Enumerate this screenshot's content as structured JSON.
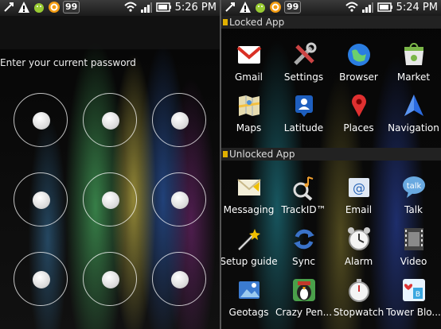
{
  "left_panel": {
    "status_bar": {
      "badge_count": "99",
      "time": "5:26 PM"
    },
    "prompt": "Enter your current password"
  },
  "right_panel": {
    "status_bar": {
      "badge_count": "99",
      "time": "5:24 PM"
    },
    "sections": {
      "locked": {
        "title": "Locked App",
        "apps": [
          {
            "label": "Gmail",
            "icon": "gmail-icon",
            "color": "#d93025"
          },
          {
            "label": "Settings",
            "icon": "settings-icon",
            "color": "#b04040"
          },
          {
            "label": "Browser",
            "icon": "browser-icon",
            "color": "#2a7de1"
          },
          {
            "label": "Market",
            "icon": "market-icon",
            "color": "#7ab648"
          },
          {
            "label": "Maps",
            "icon": "maps-icon",
            "color": "#4a90d9"
          },
          {
            "label": "Latitude",
            "icon": "latitude-icon",
            "color": "#1e5fbf"
          },
          {
            "label": "Places",
            "icon": "places-icon",
            "color": "#e03030"
          },
          {
            "label": "Navigation",
            "icon": "navigation-icon",
            "color": "#2b6be0"
          }
        ]
      },
      "unlocked": {
        "title": "Unlocked App",
        "apps": [
          {
            "label": "Messaging",
            "icon": "messaging-icon",
            "color": "#e8e2c8"
          },
          {
            "label": "TrackID™",
            "icon": "trackid-icon",
            "color": "#cccccc"
          },
          {
            "label": "Email",
            "icon": "email-icon",
            "color": "#dfe8f4"
          },
          {
            "label": "Talk",
            "icon": "talk-icon",
            "color": "#69a9e0"
          },
          {
            "label": "Setup guide",
            "icon": "setup-guide-icon",
            "color": "#f0c000"
          },
          {
            "label": "Sync",
            "icon": "sync-icon",
            "color": "#3a72c8"
          },
          {
            "label": "Alarm",
            "icon": "alarm-icon",
            "color": "#d8d8d8"
          },
          {
            "label": "Video",
            "icon": "video-icon",
            "color": "#8a8a8a"
          },
          {
            "label": "Geotags",
            "icon": "geotags-icon",
            "color": "#3b7bd0"
          },
          {
            "label": "Crazy Pen...",
            "icon": "crazy-penguin-icon",
            "color": "#4aa04a"
          },
          {
            "label": "Stopwatch",
            "icon": "stopwatch-icon",
            "color": "#e0e0e0"
          },
          {
            "label": "Tower Blo...",
            "icon": "tower-bloxx-icon",
            "color": "#3aa7e0"
          }
        ]
      }
    }
  }
}
